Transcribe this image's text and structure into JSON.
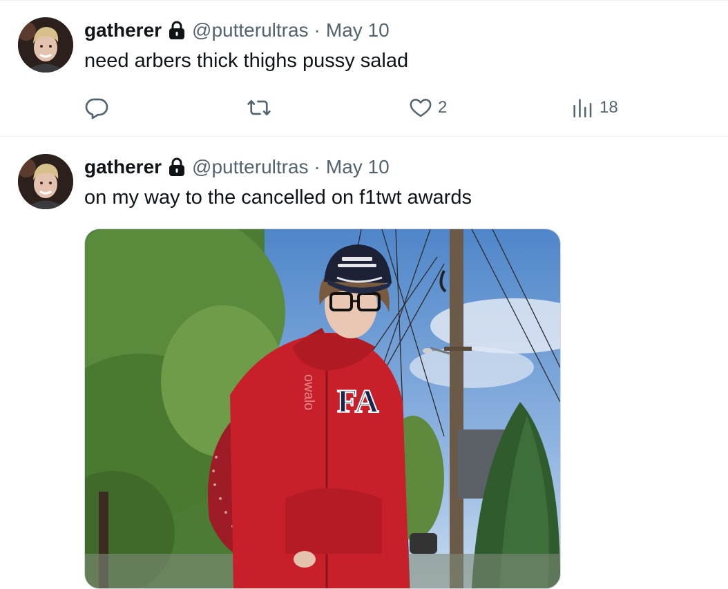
{
  "tweets": [
    {
      "author_name": "gatherer",
      "handle": "@putterultras",
      "separator": "·",
      "date": "May 10",
      "text": "need arbers thick thighs pussy salad",
      "actions": {
        "replies": "",
        "retweets": "",
        "likes": "2",
        "views": "18"
      }
    },
    {
      "author_name": "gatherer",
      "handle": "@putterultras",
      "separator": "·",
      "date": "May 10",
      "text": "on my way to the cancelled on f1twt awards",
      "media": {
        "hoodie_text": "FA",
        "bag_text": "owalo"
      }
    }
  ],
  "colors": {
    "text_primary": "#0f1419",
    "text_secondary": "#536471",
    "divider": "#eff3f4",
    "hoodie_red": "#c8202a"
  },
  "icons": [
    "lock-icon",
    "reply-icon",
    "retweet-icon",
    "like-icon",
    "views-icon"
  ]
}
